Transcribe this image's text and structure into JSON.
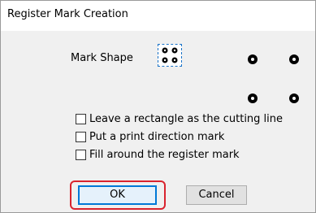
{
  "window": {
    "title": "Register Mark Creation"
  },
  "mark_shape": {
    "label": "Mark Shape",
    "selected_icon": "four-corner-dots-icon"
  },
  "options": [
    {
      "label": "Leave a rectangle as the cutting line",
      "checked": false
    },
    {
      "label": "Put a print direction mark",
      "checked": false
    },
    {
      "label": "Fill around the register mark",
      "checked": false
    }
  ],
  "buttons": {
    "ok_label": "OK",
    "cancel_label": "Cancel"
  },
  "colors": {
    "highlight": "#d9232e",
    "focus_blue": "#0078d7",
    "dialog_bg": "#f0f0f0"
  }
}
